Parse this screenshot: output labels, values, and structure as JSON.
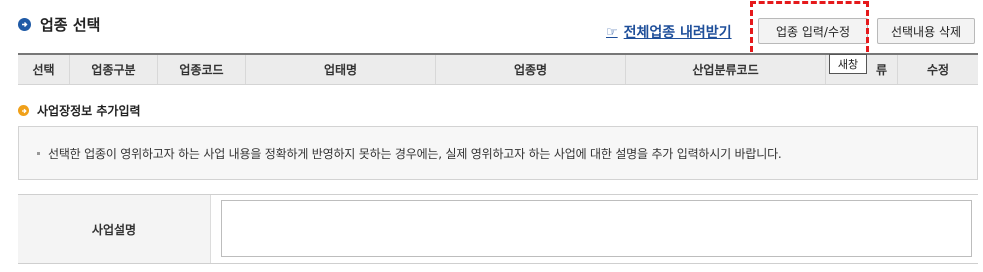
{
  "section": {
    "title": "업종 선택"
  },
  "toolbar": {
    "download_label": "전체업종 내려받기",
    "input_button": "업종 입력/수정",
    "delete_button": "선택내용 삭제"
  },
  "table": {
    "columns": [
      "선택",
      "업종구분",
      "업종코드",
      "업태명",
      "업종명",
      "산업분류코드",
      "새창",
      "수정"
    ],
    "tooltip": "새창",
    "tooltip_overlap_fragment": "류"
  },
  "additional": {
    "title": "사업장정보 추가입력",
    "notice": "선택한 업종이 영위하고자 하는 사업 내용을 정확하게 반영하지 못하는 경우에는, 실제 영위하고자 하는 사업에 대한 설명을 추가 입력하시기 바랍니다.",
    "field_label": "사업설명",
    "field_value": ""
  },
  "colors": {
    "accent_blue": "#1f5aa6",
    "accent_orange": "#f0a019",
    "highlight_red": "#e5191b"
  },
  "icons": [
    "circle-arrow-icon",
    "hand-pointer-icon",
    "orange-circle-arrow-icon"
  ]
}
